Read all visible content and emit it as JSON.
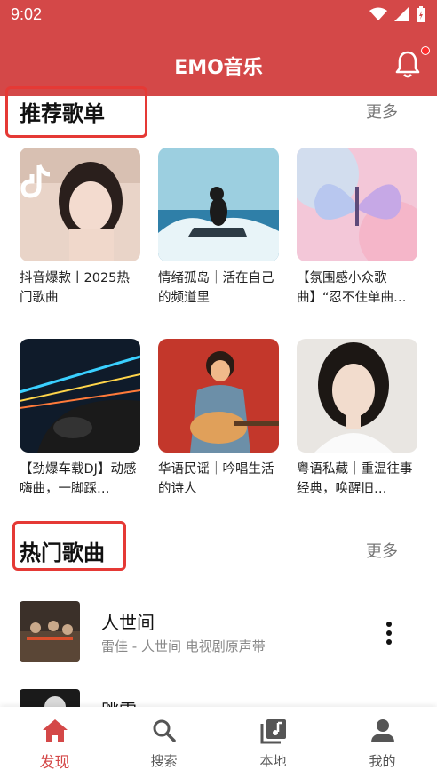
{
  "status_bar": {
    "time": "9:02"
  },
  "app_bar": {
    "title": "EMO音乐"
  },
  "recommended": {
    "title": "推荐歌单",
    "more": "更多",
    "playlists": [
      {
        "title": "抖音爆款丨2025热门歌曲"
      },
      {
        "title": "情绪孤岛｜活在自己的频道里"
      },
      {
        "title": "【氛围感小众歌曲】“忍不住单曲…"
      },
      {
        "title": "【劲爆车载DJ】动感嗨曲，一脚踩…"
      },
      {
        "title": "华语民谣｜吟唱生活的诗人"
      },
      {
        "title": "粤语私藏｜重温往事经典，唤醒旧…"
      }
    ]
  },
  "hot_songs": {
    "title": "热门歌曲",
    "more": "更多",
    "songs": [
      {
        "title": "人世间",
        "subtitle": "雷佳 - 人世间 电视剧原声带"
      },
      {
        "title": "跳雪",
        "subtitle": ""
      }
    ]
  },
  "bottom_nav": {
    "items": [
      {
        "label": "发现"
      },
      {
        "label": "搜索"
      },
      {
        "label": "本地"
      },
      {
        "label": "我的"
      }
    ]
  },
  "colors": {
    "primary": "#d44848",
    "highlight_box": "#e53935"
  }
}
